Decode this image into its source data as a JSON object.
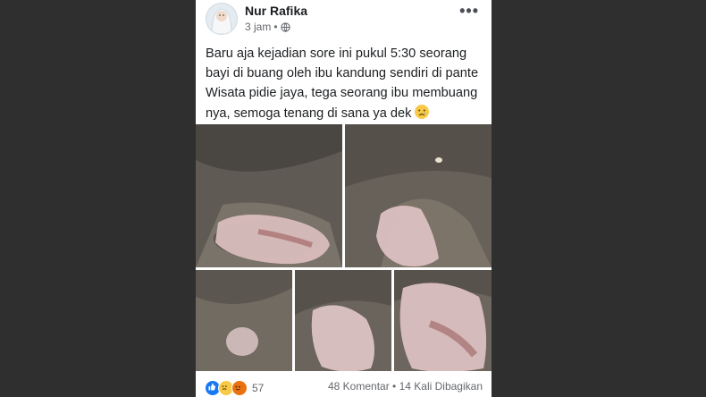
{
  "post": {
    "author": "Nur Rafika",
    "time": "3 jam",
    "separator": "•",
    "privacy_icon": "globe-icon",
    "more_icon": "more-options-icon",
    "text": "Baru aja kejadian sore ini pukul 5:30 seorang bayi di buang oleh ibu kandung sendiri di pante Wisata pidie jaya, tega seorang ibu membuang nya, semoga tenang di sana ya dek",
    "text_emoji": "crying-face-emoji"
  },
  "photos": {
    "count_shown": 5,
    "description_note": ""
  },
  "footer": {
    "reactions": [
      "like",
      "sad",
      "angry"
    ],
    "reaction_count": "57",
    "comments": "48 Komentar",
    "dot": "•",
    "shares": "14 Kali Dibagikan"
  },
  "colors": {
    "background": "#2f2f2f",
    "card": "#ffffff",
    "text": "#1c1e21",
    "secondary": "#65676b",
    "like": "#1877f2"
  }
}
